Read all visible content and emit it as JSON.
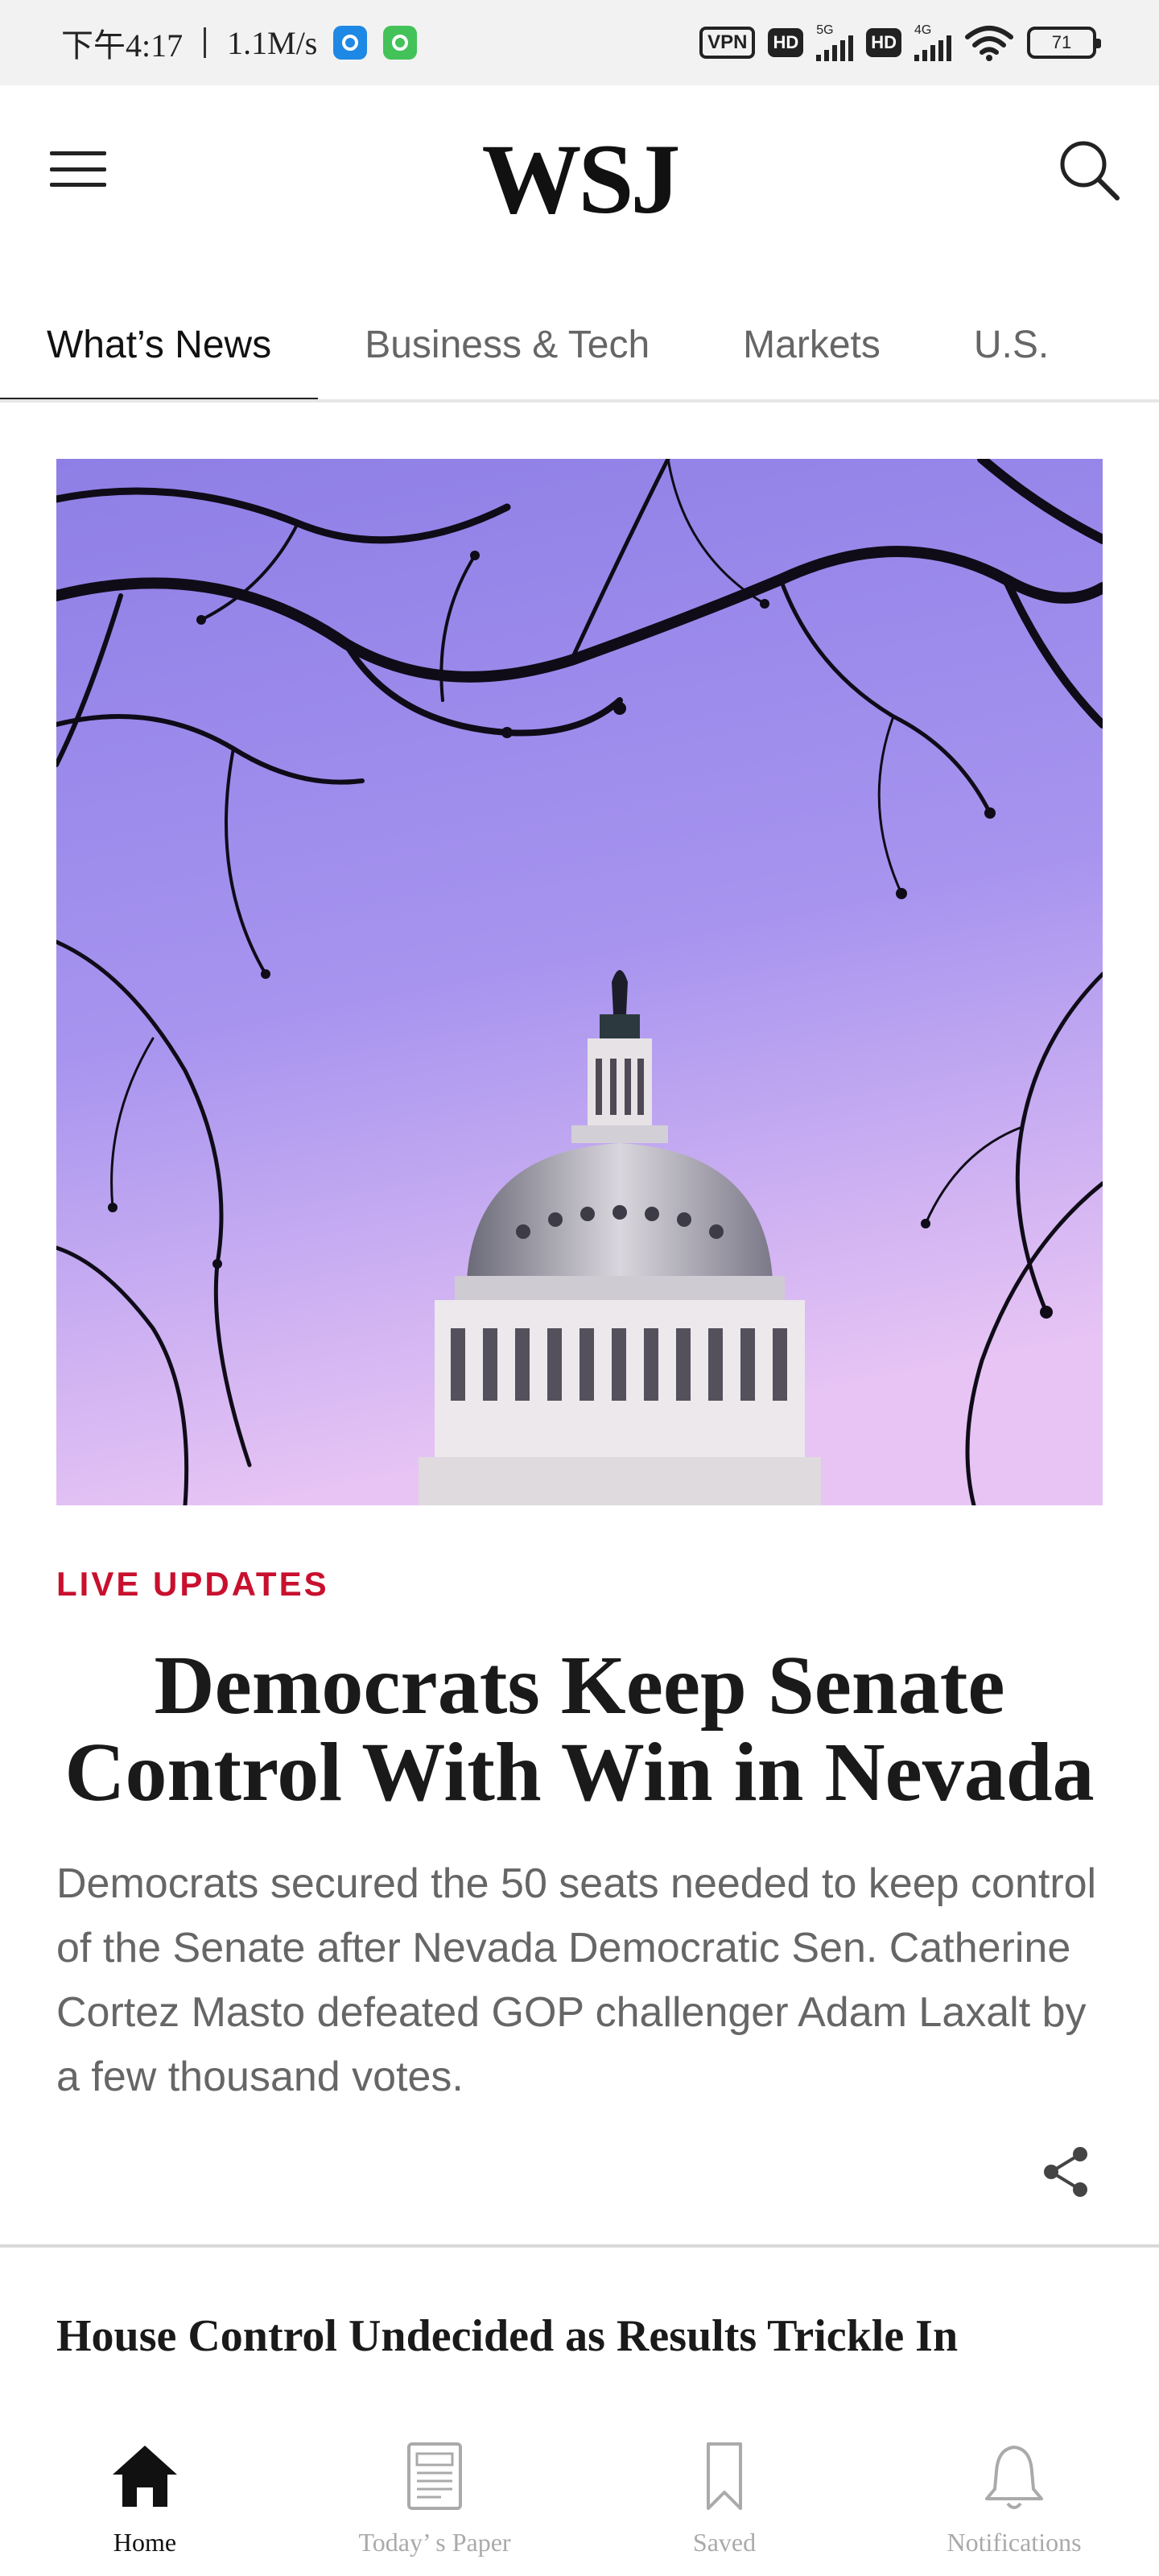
{
  "status_bar": {
    "time": "下午4:17",
    "speed": "1.1M/s",
    "vpn": "VPN",
    "hd1": "HD",
    "net1": "5G",
    "hd2": "HD",
    "net2": "4G",
    "battery": "71"
  },
  "header": {
    "logo": "WSJ",
    "menu_icon": "hamburger-menu-icon",
    "search_icon": "search-icon"
  },
  "tabs": [
    {
      "label": "What’s News",
      "active": true
    },
    {
      "label": "Business & Tech",
      "active": false
    },
    {
      "label": "Markets",
      "active": false
    },
    {
      "label": "U.S.",
      "active": false
    }
  ],
  "article": {
    "label": "LIVE UPDATES",
    "label_color": "#c8102e",
    "headline": "Democrats Keep Senate Control With Win in Nevada",
    "summary": "Democrats secured the 50 seats needed to keep control of the Senate after Nevada Democratic Sen. Catherine Cortez Masto defeated GOP challenger Adam Laxalt by a few thousand votes.",
    "share_icon": "share-icon"
  },
  "next_article": {
    "headline": "House Control Undecided as Results Trickle In"
  },
  "bottom_nav": [
    {
      "label": "Home",
      "icon": "home-icon",
      "active": true
    },
    {
      "label": "Today’ s Paper",
      "icon": "newspaper-icon",
      "active": false
    },
    {
      "label": "Saved",
      "icon": "bookmark-icon",
      "active": false
    },
    {
      "label": "Notifications",
      "icon": "bell-icon",
      "active": false
    }
  ]
}
